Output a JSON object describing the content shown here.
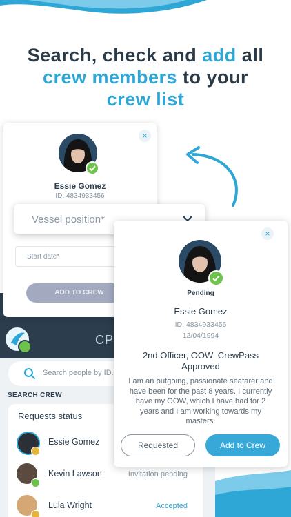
{
  "headline": {
    "line1_a": "Search, check and ",
    "line1_b": "add",
    "line1_c": " all",
    "line2_a": "crew members",
    "line2_b": " to your",
    "line3": "crew list"
  },
  "colors": {
    "accent": "#2ea7d6",
    "dark_text": "#2b3a47",
    "success_green": "#6cc24a",
    "button_blue": "#38a8d8",
    "disabled_button": "#a3aac0"
  },
  "left_card": {
    "name": "Essie Gomez",
    "id_text": "ID: 4834933456",
    "close_glyph": "×",
    "position_placeholder": "Vessel position*",
    "start_date_placeholder": "Start date*",
    "add_button": "ADD TO CREW"
  },
  "right_card": {
    "close_glyph": "×",
    "status": "Pending",
    "name": "Essie Gomez",
    "id_text": "ID: 4834933456",
    "dob": "12/04/1994",
    "role": "2nd Officer, OOW, CrewPass Approved",
    "bio": "I am an outgoing, passionate seafarer and have been for the past 8 years. I currently have my OOW, which I have had for 2 years and I am working towards my masters.",
    "requested_button": "Requested",
    "add_button": "Add to Crew"
  },
  "phone": {
    "title": "CP",
    "search_placeholder": "Search people by ID...",
    "section_label": "SEARCH CREW",
    "requests_title": "Requests status",
    "rows": [
      {
        "name": "Essie Gomez",
        "status": ""
      },
      {
        "name": "Kevin Lawson",
        "status": "Invitation pending"
      },
      {
        "name": "Lula Wright",
        "status": "Accepted"
      }
    ]
  }
}
